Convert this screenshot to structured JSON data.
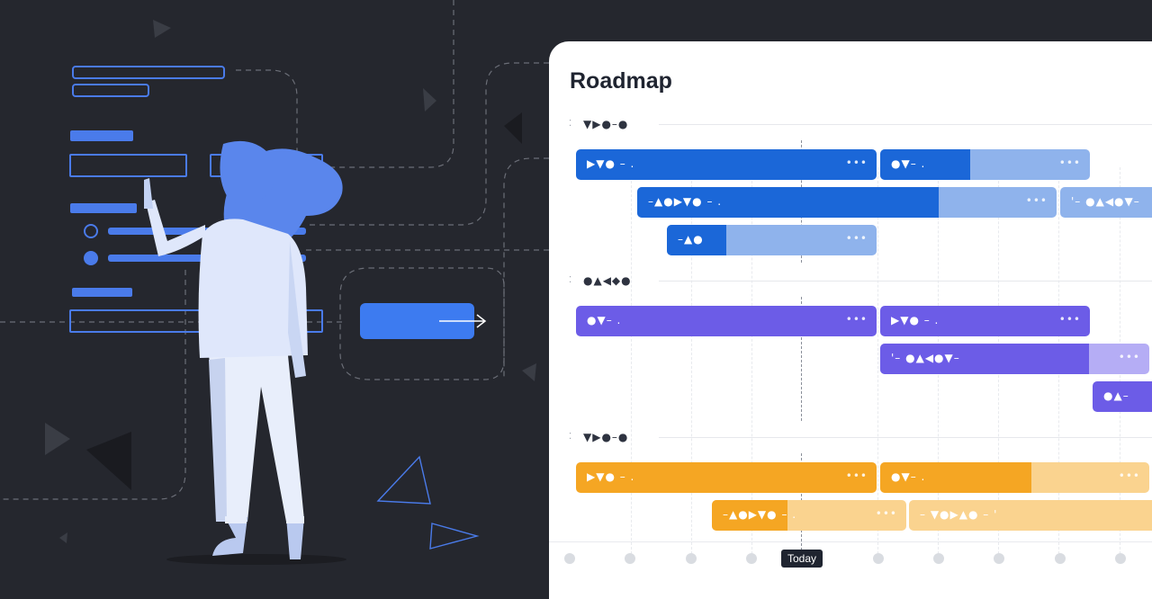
{
  "roadmap": {
    "title": "Roadmap",
    "today_label": "Today",
    "colors": {
      "background": "#25272e",
      "blue_dark": "#1b67d8",
      "blue_light": "#8fb3ec",
      "purple_dark": "#6c5ce7",
      "purple_light": "#b5adf5",
      "orange_dark": "#f5a623",
      "orange_light": "#fad38f",
      "accent_illustration": "#4a7bea"
    },
    "groups": [
      {
        "label": "▼▶●–●",
        "bars": [
          {
            "label": "▶▼● – .",
            "more": "•••",
            "progress": 1.0
          },
          {
            "label": "●▼– .",
            "more": "•••",
            "progress": 0.43
          },
          {
            "label": "–▲●▶▼● – .",
            "more": "•••",
            "progress": 0.72
          },
          {
            "label": "'– ●▲◀●▼–",
            "more": "",
            "progress": 0.0
          },
          {
            "label": "–▲●",
            "more": "•••",
            "progress": 0.28
          }
        ]
      },
      {
        "label": "●▲◀◆●",
        "bars": [
          {
            "label": "●▼– .",
            "more": "•••",
            "progress": 1.0
          },
          {
            "label": "▶▼● – .",
            "more": "•••",
            "progress": 1.0
          },
          {
            "label": "'– ●▲◀●▼–",
            "more": "•••",
            "progress": 0.78
          },
          {
            "label": "●▲–",
            "more": "",
            "progress": 1.0
          }
        ]
      },
      {
        "label": "▼▶●–●",
        "bars": [
          {
            "label": "▶▼● – .",
            "more": "•••",
            "progress": 1.0
          },
          {
            "label": "●▼– .",
            "more": "•••",
            "progress": 0.56
          },
          {
            "label": "–▲●▶▼● – .",
            "more": "•••",
            "progress": 0.39
          },
          {
            "label": "– ▼●▶▲● – '",
            "more": "",
            "progress": 0.0
          }
        ]
      }
    ]
  }
}
